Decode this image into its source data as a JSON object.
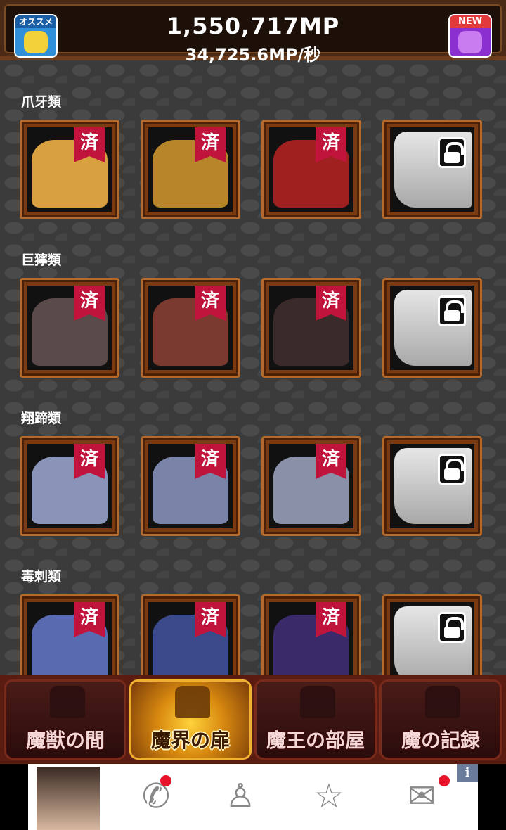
{
  "header": {
    "mp_total": "1,550,717MP",
    "mp_rate": "34,725.6MP/秒",
    "recommend_badge": "オススメ",
    "new_badge": "NEW"
  },
  "categories": [
    {
      "title": "爪牙類",
      "tiles": [
        {
          "state": "done",
          "color": "#d9a040"
        },
        {
          "state": "done",
          "color": "#b8862a"
        },
        {
          "state": "done",
          "color": "#a02020"
        },
        {
          "state": "locked"
        }
      ]
    },
    {
      "title": "巨獰類",
      "tiles": [
        {
          "state": "done",
          "color": "#5a4a4a"
        },
        {
          "state": "done",
          "color": "#7a3a30"
        },
        {
          "state": "done",
          "color": "#3a2a2a"
        },
        {
          "state": "locked"
        }
      ]
    },
    {
      "title": "翔蹄類",
      "tiles": [
        {
          "state": "done",
          "color": "#8a94b8"
        },
        {
          "state": "done",
          "color": "#7a84a8"
        },
        {
          "state": "done",
          "color": "#8a90a8"
        },
        {
          "state": "locked"
        }
      ]
    },
    {
      "title": "毒刺類",
      "tiles": [
        {
          "state": "done",
          "color": "#5a6ab0"
        },
        {
          "state": "done",
          "color": "#3a4a8a"
        },
        {
          "state": "done",
          "color": "#3a2a6a"
        },
        {
          "state": "locked"
        }
      ]
    }
  ],
  "done_label": "済",
  "nav": [
    {
      "label": "魔獣の間",
      "active": false
    },
    {
      "label": "魔界の扉",
      "active": true
    },
    {
      "label": "魔王の部屋",
      "active": false
    },
    {
      "label": "魔の記録",
      "active": false
    }
  ],
  "ad": {
    "info_label": "i",
    "icons": [
      "phone-icon",
      "person-icon",
      "star-icon",
      "mail-icon"
    ]
  }
}
